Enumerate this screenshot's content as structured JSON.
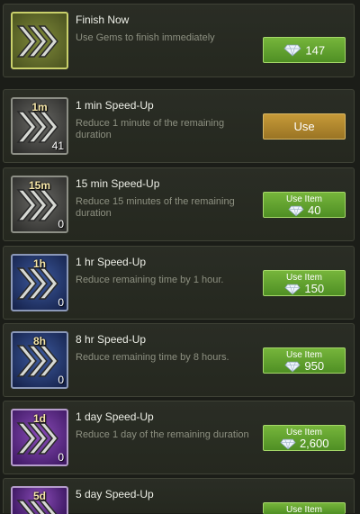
{
  "items": [
    {
      "title": "Finish Now",
      "description": "Use Gems to finish immediately",
      "button": {
        "type": "gems",
        "value": "147"
      }
    },
    {
      "title": "1 min Speed-Up",
      "description": "Reduce 1 minute of the remaining duration",
      "tag": "1m",
      "count": "41",
      "button": {
        "type": "use",
        "label": "Use"
      }
    },
    {
      "title": "15 min Speed-Up",
      "description": "Reduce 15 minutes of the remaining duration",
      "tag": "15m",
      "count": "0",
      "button": {
        "type": "use-item",
        "label": "Use Item",
        "value": "40"
      }
    },
    {
      "title": "1 hr Speed-Up",
      "description": "Reduce remaining time by 1 hour.",
      "tag": "1h",
      "count": "0",
      "button": {
        "type": "use-item",
        "label": "Use Item",
        "value": "150"
      }
    },
    {
      "title": "8 hr Speed-Up",
      "description": "Reduce remaining time by 8 hours.",
      "tag": "8h",
      "count": "0",
      "button": {
        "type": "use-item",
        "label": "Use Item",
        "value": "950"
      }
    },
    {
      "title": "1 day Speed-Up",
      "description": "Reduce 1 day of the remaining duration",
      "tag": "1d",
      "count": "0",
      "button": {
        "type": "use-item",
        "label": "Use Item",
        "value": "2,600"
      }
    },
    {
      "title": "5 day Speed-Up",
      "tag": "5d",
      "button": {
        "type": "use-item",
        "label": "Use Item"
      }
    }
  ],
  "colors": {
    "gem_button": "#5fa22e",
    "use_button": "#b58a30",
    "icon_olive": "#7f8a3a",
    "icon_blue": "#3d5a9e",
    "icon_purple": "#8a4cb8"
  },
  "icons": {
    "speedup": "triple-chevron-arrow-icon",
    "gem": "diamond-gem-icon"
  }
}
